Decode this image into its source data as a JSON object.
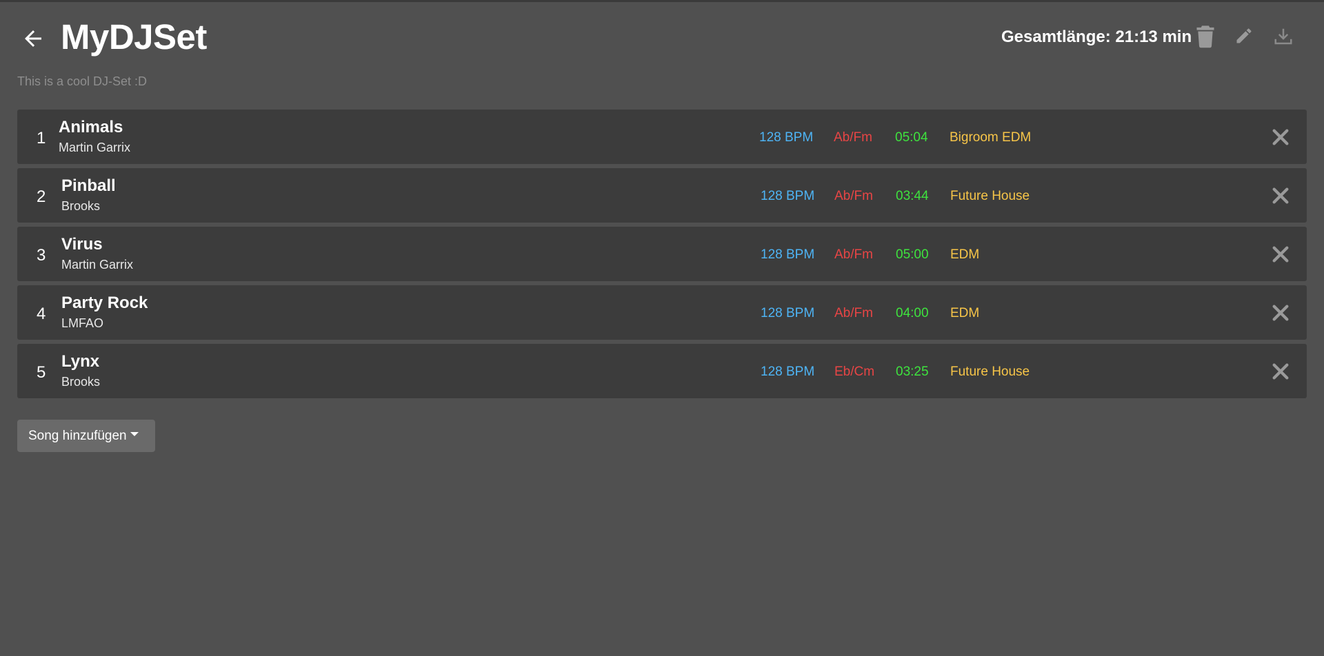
{
  "header": {
    "title": "MyDJSet",
    "description": "This is a cool DJ-Set :D",
    "total_length": "Gesamtlänge: 21:13 min"
  },
  "icons": {
    "back": "arrow-left-icon",
    "delete_set": "trash-icon",
    "edit_set": "pencil-icon",
    "download_set": "download-icon",
    "remove_song": "close-icon",
    "dropdown": "caret-down-icon"
  },
  "colors": {
    "background": "#505050",
    "row_background": "#3c3c3c",
    "bpm": "#4eb4f5",
    "key": "#e84545",
    "length": "#3ee33e",
    "genre": "#f7c548"
  },
  "songs": [
    {
      "number": "1",
      "title": "Animals",
      "artist": "Martin Garrix",
      "bpm": "128 BPM",
      "key": "Ab/Fm",
      "length": "05:04",
      "genre": "Bigroom EDM"
    },
    {
      "number": "2",
      "title": "Pinball",
      "artist": "Brooks",
      "bpm": "128 BPM",
      "key": "Ab/Fm",
      "length": "03:44",
      "genre": "Future House"
    },
    {
      "number": "3",
      "title": "Virus",
      "artist": "Martin Garrix",
      "bpm": "128 BPM",
      "key": "Ab/Fm",
      "length": "05:00",
      "genre": "EDM"
    },
    {
      "number": "4",
      "title": "Party Rock",
      "artist": "LMFAO",
      "bpm": "128 BPM",
      "key": "Ab/Fm",
      "length": "04:00",
      "genre": "EDM"
    },
    {
      "number": "5",
      "title": "Lynx",
      "artist": "Brooks",
      "bpm": "128 BPM",
      "key": "Eb/Cm",
      "length": "03:25",
      "genre": "Future House"
    }
  ],
  "actions": {
    "add_song_label": "Song hinzufügen"
  }
}
